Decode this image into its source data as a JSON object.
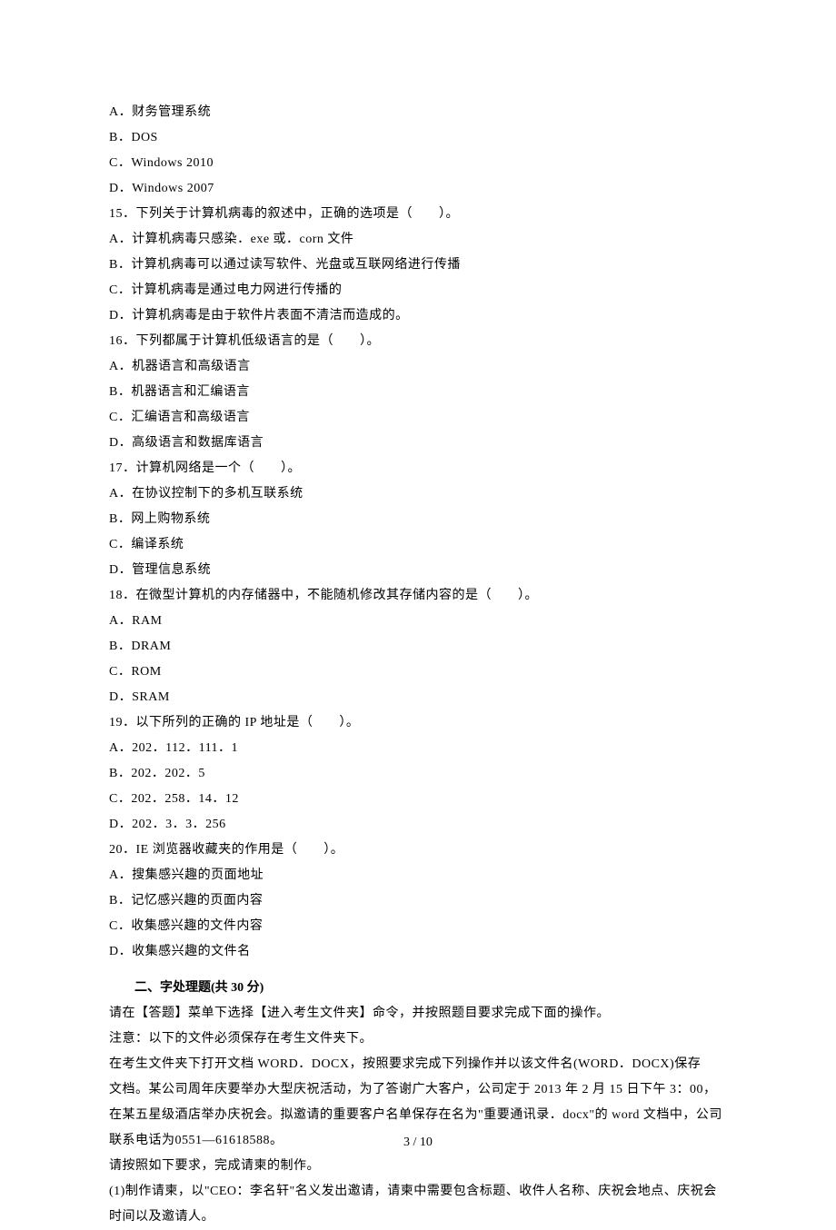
{
  "lines": [
    "A．财务管理系统",
    "B．DOS",
    "C．Windows 2010",
    "D．Windows 2007",
    "15．下列关于计算机病毒的叙述中，正确的选项是（　　）。",
    "A．计算机病毒只感染．exe 或．corn 文件",
    "B．计算机病毒可以通过读写软件、光盘或互联网络进行传播",
    "C．计算机病毒是通过电力网进行传播的",
    "D．计算机病毒是由于软件片表面不清洁而造成的。",
    "16．下列都属于计算机低级语言的是（　　）。",
    "A．机器语言和高级语言",
    "B．机器语言和汇编语言",
    "C．汇编语言和高级语言",
    "D．高级语言和数据库语言",
    "17．计算机网络是一个（　　）。",
    "A．在协议控制下的多机互联系统",
    "B．网上购物系统",
    "C．编译系统",
    "D．管理信息系统",
    "18．在微型计算机的内存储器中，不能随机修改其存储内容的是（　　）。",
    "A．RAM",
    "B．DRAM",
    "C．ROM",
    "D．SRAM",
    "19．以下所列的正确的 IP 地址是（　　）。",
    "A．202．112．111．1",
    "B．202．202．5",
    "C．202．258．14．12",
    "D．202．3．3．256",
    "20．IE 浏览器收藏夹的作用是（　　）。",
    "A．搜集感兴趣的页面地址",
    "B．记忆感兴趣的页面内容",
    "C．收集感兴趣的文件内容",
    "D．收集感兴趣的文件名"
  ],
  "section_title": "二、字处理题(共 30 分)",
  "paragraphs": [
    "请在【答题】菜单下选择【进入考生文件夹】命令，并按照题目要求完成下面的操作。",
    "注意：以下的文件必须保存在考生文件夹下。",
    "在考生文件夹下打开文档 WORD．DOCX，按照要求完成下列操作并以该文件名(WORD．DOCX)保存",
    "文档。某公司周年庆要举办大型庆祝活动，为了答谢广大客户，公司定于 2013 年 2 月 15 日下午 3：00，在某五星级酒店举办庆祝会。拟邀请的重要客户名单保存在名为\"重要通讯录．docx\"的 word 文档中，公司联系电话为0551—61618588。",
    "请按照如下要求，完成请柬的制作。",
    "(1)制作请柬，以\"CEO：李名轩\"名义发出邀请，请柬中需要包含标题、收件人名称、庆祝会地点、庆祝会时间以及邀请人。"
  ],
  "footer": "3  /  10"
}
